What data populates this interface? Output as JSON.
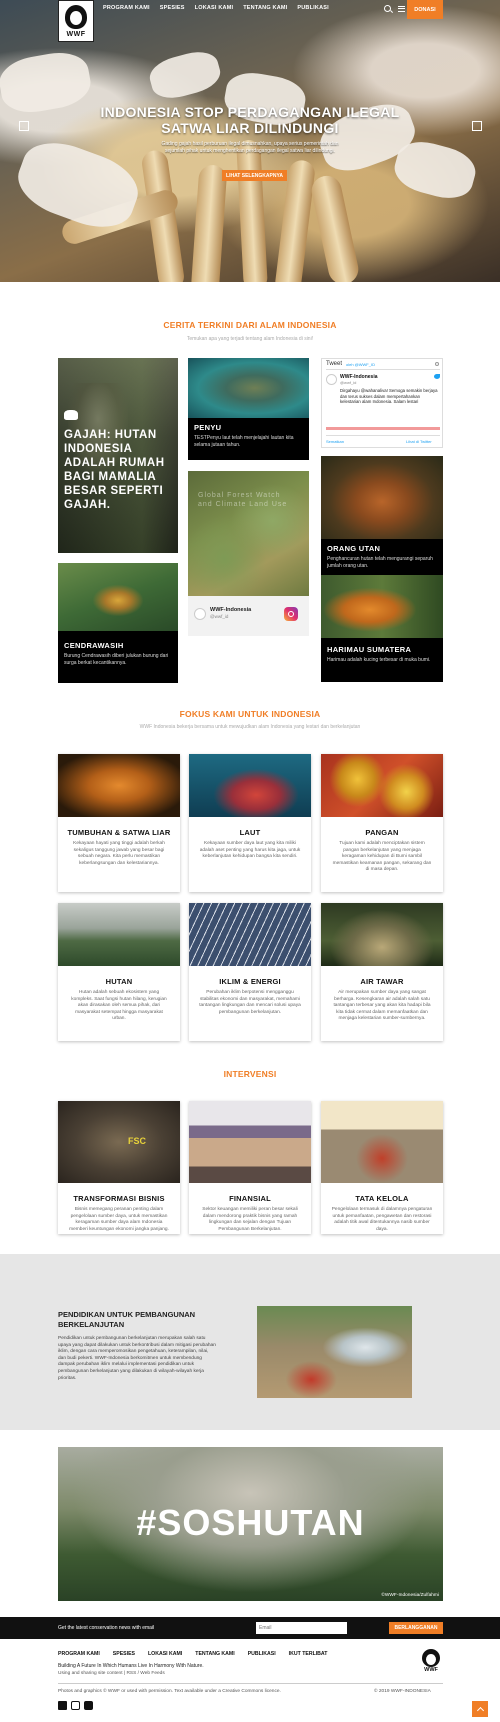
{
  "nav": {
    "links": [
      "PROGRAM KAMI",
      "SPESIES",
      "LOKASI KAMI",
      "TENTANG KAMI",
      "PUBLIKASI"
    ],
    "donate_label": "DONASI",
    "logo_text": "WWF"
  },
  "hero": {
    "title_line1": "INDONESIA STOP PERDAGANGAN ILEGAL",
    "title_line2": "SATWA LIAR DILINDUNGI",
    "subtitle": "Gading gajah hasil perburuan ilegal dimusnahkan, upaya serius pemerintah dan sejumlah pihak untuk menghentikan perdagangan ilegal satwa liar dilindungi.",
    "button_label": "LIHAT SELENGKAPNYA"
  },
  "stories": {
    "heading": "CERITA TERKINI DARI ALAM INDONESIA",
    "subheading": "Temukan apa yang terjadi tentang alam Indonesia di sini!",
    "gajah": {
      "title": "GAJAH: HUTAN INDONESIA ADALAH RUMAH BAGI MAMALIA BESAR SEPERTI GAJAH."
    },
    "penyu": {
      "title": "PENYU",
      "desc": "TESTPenyu laut telah menjelajahi lautan kita selama jutaan tahun."
    },
    "instagram": {
      "account": "WWF-Indonesia",
      "handle": "@wwf_id",
      "overlay": "Global Forest Watch and Climate Land Use"
    },
    "orangutan": {
      "title": "ORANG UTAN",
      "desc": "Penghancuran hutan telah mengurangi separuh jumlah orang utan."
    },
    "cendrawasih": {
      "title": "CENDRAWASIH",
      "desc": "Burung Cendrawasih diberi julukan burung dari surga berkat kecantikannya."
    },
    "harimau": {
      "title": "HARIMAU SUMATERA",
      "desc": "Harimau adalah kucing terbesar di muka bumi."
    }
  },
  "tweet": {
    "header": "Tweet",
    "by": "oleh @WWF_ID",
    "account": "WWF-Indonesia",
    "handle": "@wwf_id",
    "text": "Dirgahayu @wahanaliva! Semoga semakin berjaya dan terus sukses dalam mempertahankan kelestarian alam Indonesia. Salam lestari",
    "embed_label": "Sematkan",
    "view_label": "Lihat di Twitter"
  },
  "focus": {
    "heading": "FOKUS KAMI UNTUK INDONESIA",
    "subheading": "WWF Indonesia bekerja bersama untuk mewujudkan alam Indonesia yang lestari dan berkelanjutan",
    "cards": [
      {
        "title": "TUMBUHAN & SATWA LIAR",
        "desc": "Kekayaan hayati yang tinggi adalah berkah sekaligus tanggung jawab yang besar bagi sebuah negara. Kita perlu memastikan keberlangsungan dan kelestariannya."
      },
      {
        "title": "LAUT",
        "desc": "Kekayaan sumber daya laut yang kita miliki adalah aset penting yang harus kita jaga, untuk keberlanjutan kehidupan bangsa kita sendiri."
      },
      {
        "title": "PANGAN",
        "desc": "Tujuan kami adalah menciptakan sistem pangan berkelanjutan yang menjaga keragaman kehidupan di Bumi sambil memastikan keamanan pangan, sekarang dan di masa depan."
      },
      {
        "title": "HUTAN",
        "desc": "Hutan adalah sebuah ekosistem yang kompleks. Saat fungsi hutan hilang, kerugian akan dirasakan oleh semua pihak, dari masyarakat setempat hingga masyarakat urban."
      },
      {
        "title": "IKLIM & ENERGI",
        "desc": "Perubahan iklim berpotensi mengganggu stabilitas ekonomi dan masyarakat, memahami tantangan lingkungan dan mencari solusi upaya pembangunan berkelanjutan."
      },
      {
        "title": "AIR TAWAR",
        "desc": "Air merupakan sumber daya yang sangat berharga. Kesengkaran air adalah salah satu tantangan terbesar yang akan kita hadapi bila kita tidak cermat dalam memanfaatkan dan menjaga kelestarian sumber-sumbernya."
      }
    ]
  },
  "intervensi": {
    "heading": "INTERVENSI",
    "cards": [
      {
        "title": "TRANSFORMASI BISNIS",
        "desc": "Bisnis memegang peranan penting dalam pengelolaan sumber daya, untuk memastikan keragaman sumber daya alam Indonesia memberi keuntungan ekonomi jangka panjang.",
        "logo": "FSC"
      },
      {
        "title": "FINANSIAL",
        "desc": "Sektor keuangan memiliki peran besar sekali dalam mendorong praktik bisnis yang ramah lingkungan dan sejalan dengan Tujuan Pembangunan Berkelanjutan."
      },
      {
        "title": "TATA KELOLA",
        "desc": "Pengelolaan termasuk di dalamnya pengaturan untuk pemanfaatan, pengawetan dan restorasi adalah titik awal ditentukannya nasib sumber daya."
      }
    ]
  },
  "education": {
    "title_line1": "PENDIDIKAN UNTUK PEMBANGUNAN",
    "title_line2": "BERKELANJUTAN",
    "desc": "Pendidikan untuk pembangunan berkelanjutan merupakan salah satu upaya yang dapat dilakukan untuk berkontribusi dalam mitigasi perubahan iklim, dengan cara memperomosikan pengetahuan, keterampilan, nilai, dan budi pekerti. WWF-Indonesia berkomitmen untuk membendung dampak perubahan iklim melalui implementasi pendidikan untuk pembangunan berkelanjutan yang dilakukan di wilayah-wilayah kerja prioritas."
  },
  "soshutan": {
    "hashtag": "#SOSHUTAN",
    "credit": "©WWF-Indonesia/Zulfahmi"
  },
  "subscribe": {
    "text": "Get the latest conservation news with email",
    "input_placeholder": "Email",
    "button_label": "BERLANGGANAN"
  },
  "footer": {
    "links": [
      "PROGRAM KAMI",
      "SPESIES",
      "LOKASI KAMI",
      "TENTANG KAMI",
      "PUBLIKASI",
      "IKUT TERLIBAT"
    ],
    "tagline": "Building A Future In Which Humans Live In Harmony With Nature.",
    "sub_links": "Using and sharing site content | RSS / Web Feeds",
    "copyright_left": "Photos and graphics © WWF or used with permission. Text available under a Creative Commons licence.",
    "copyright_right": "© 2019 WWF-INDONESIA",
    "logo_text": "WWF"
  },
  "colors": {
    "accent": "#f07e26",
    "dark": "#111111",
    "grey_band": "#e6e6e6"
  }
}
